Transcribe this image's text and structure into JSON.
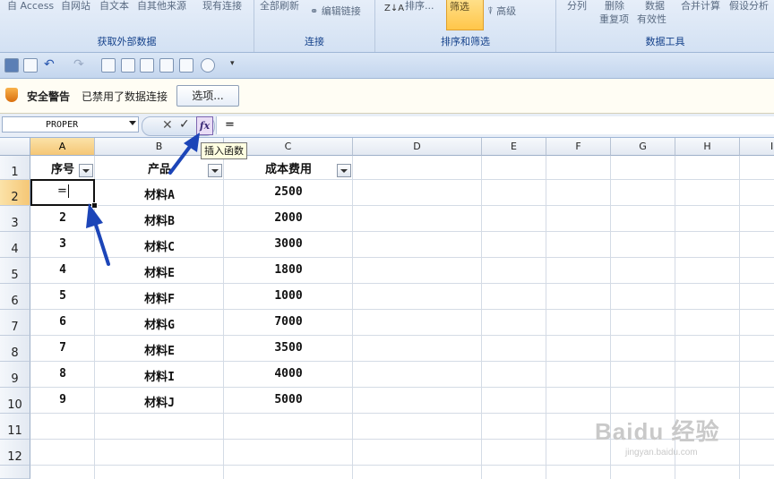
{
  "ribbon": {
    "row_top": [
      "自 Access",
      "自网站",
      "自文本",
      "自其他来源",
      "现有连接",
      "全部刷新",
      "编辑链接",
      "排序...",
      "筛选",
      "高级",
      "分列",
      "删除",
      "数据",
      "合并计算",
      "假设分析"
    ],
    "row_mid": [
      "重复项",
      "有效性"
    ],
    "groups": [
      "获取外部数据",
      "连接",
      "排序和筛选",
      "数据工具"
    ],
    "sort_icon_text": "Z↓A"
  },
  "security": {
    "title": "安全警告",
    "message": "已禁用了数据连接",
    "options_button": "选项..."
  },
  "formula_bar": {
    "name_box": "PROPER",
    "cancel_glyph": "✕",
    "enter_glyph": "✓",
    "fx_label": "fx",
    "formula": "=",
    "tooltip": "插入函数"
  },
  "grid": {
    "columns": [
      "A",
      "B",
      "C",
      "D",
      "E",
      "F",
      "G",
      "H",
      "I"
    ],
    "rows": [
      "1",
      "2",
      "3",
      "4",
      "5",
      "6",
      "7",
      "8",
      "9",
      "10",
      "11",
      "12"
    ],
    "headers": [
      "序号",
      "产品",
      "成本费用"
    ],
    "active_cell_text": "=",
    "data": [
      [
        "",
        "材料A",
        "2500"
      ],
      [
        "2",
        "材料B",
        "2000"
      ],
      [
        "3",
        "材料C",
        "3000"
      ],
      [
        "4",
        "材料E",
        "1800"
      ],
      [
        "5",
        "材料F",
        "1000"
      ],
      [
        "6",
        "材料G",
        "7000"
      ],
      [
        "7",
        "材料E",
        "3500"
      ],
      [
        "8",
        "材料I",
        "4000"
      ],
      [
        "9",
        "材料J",
        "5000"
      ]
    ]
  },
  "watermark": {
    "logo": "Baidu 经验",
    "url": "jingyan.baidu.com"
  },
  "colors": {
    "arrow": "#1c45b8",
    "selection_header": "#f5c776",
    "fx_button": "#e9ddf6"
  }
}
